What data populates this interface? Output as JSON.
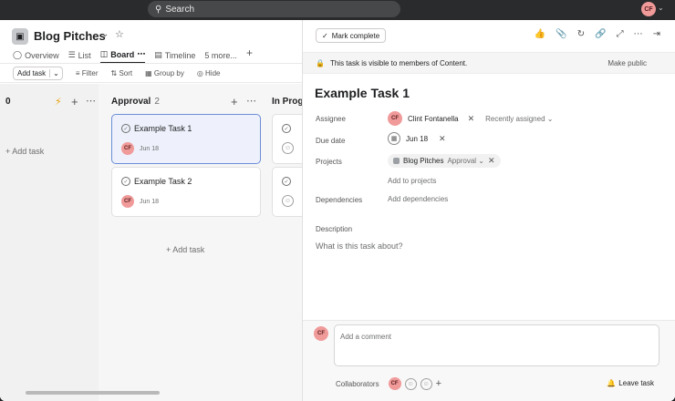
{
  "topbar": {
    "search_placeholder": "Search",
    "avatar_initials": "CF"
  },
  "project": {
    "title": "Blog Pitches",
    "tabs": [
      {
        "label": "Overview"
      },
      {
        "label": "List"
      },
      {
        "label": "Board"
      },
      {
        "label": "Timeline"
      },
      {
        "label": "5 more..."
      }
    ],
    "toolbar": {
      "add_task": "Add task",
      "filter": "Filter",
      "sort": "Sort",
      "group_by": "Group by",
      "hide": "Hide"
    }
  },
  "board": {
    "col0": {
      "count": "0",
      "add_task": "+ Add task"
    },
    "approval": {
      "title": "Approval",
      "count": "2",
      "cards": [
        {
          "title": "Example Task 1",
          "avatar": "CF",
          "date": "Jun 18"
        },
        {
          "title": "Example Task 2",
          "avatar": "CF",
          "date": "Jun 18"
        }
      ],
      "add_task": "+ Add task"
    },
    "inprogress": {
      "title": "In Progre"
    }
  },
  "panel": {
    "mark_complete": "Mark complete",
    "notice": "This task is visible to members of Content.",
    "make_public": "Make public",
    "task_title": "Example Task 1",
    "labels": {
      "assignee": "Assignee",
      "due_date": "Due date",
      "projects": "Projects",
      "dependencies": "Dependencies",
      "description": "Description"
    },
    "assignee": {
      "initials": "CF",
      "name": "Clint Fontanella",
      "recent": "Recently assigned"
    },
    "due": "Jun 18",
    "project_chip": {
      "name": "Blog Pitches",
      "section": "Approval"
    },
    "add_to_projects": "Add to projects",
    "add_dependencies": "Add dependencies",
    "description_placeholder": "What is this task about?",
    "comment_placeholder": "Add a comment",
    "collaborators": "Collaborators",
    "leave_task": "Leave task"
  }
}
